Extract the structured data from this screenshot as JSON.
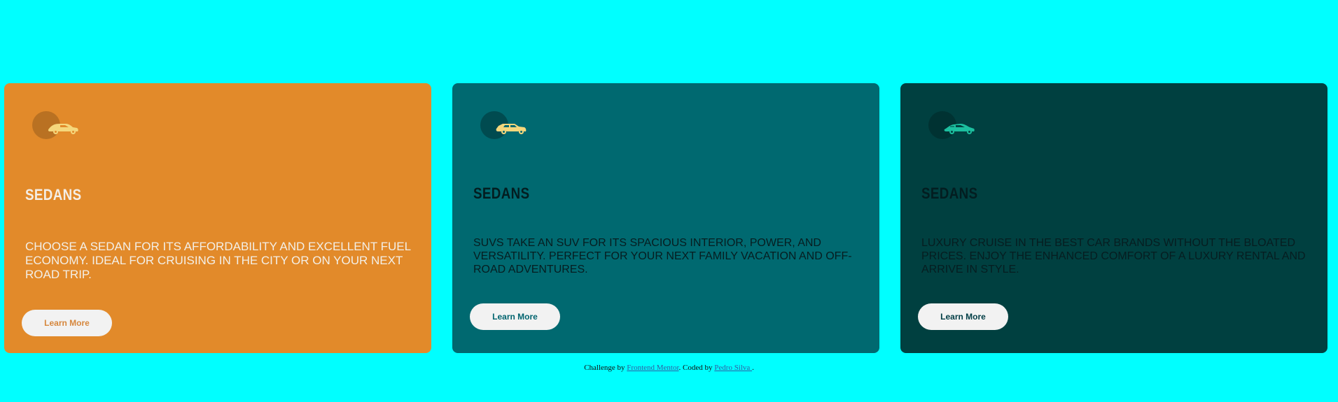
{
  "cards": [
    {
      "title": "SEDANS",
      "description": "CHOOSE A SEDAN FOR ITS AFFORDABILITY AND EXCELLENT FUEL ECONOMY. IDEAL FOR CRUISING IN THE CITY OR ON YOUR NEXT ROAD TRIP.",
      "button_label": "Learn More",
      "background_color": "#e28a2a",
      "icon": "sedan-car-icon"
    },
    {
      "title": "SEDANS",
      "description": "SUVS TAKE AN SUV FOR ITS SPACIOUS INTERIOR, POWER, AND VERSATILITY. PERFECT FOR YOUR NEXT FAMILY VACATION AND OFF-ROAD ADVENTURES.",
      "button_label": "Learn More",
      "background_color": "#006970",
      "icon": "suv-car-icon"
    },
    {
      "title": "SEDANS",
      "description": "LUXURY CRUISE IN THE BEST CAR BRANDS WITHOUT THE BLOATED PRICES. ENJOY THE ENHANCED COMFORT OF A LUXURY RENTAL AND ARRIVE IN STYLE.",
      "button_label": "Learn More",
      "background_color": "#004040",
      "icon": "luxury-car-icon"
    }
  ],
  "footer": {
    "prefix": "Challenge by ",
    "link1": "Frontend Mentor",
    "middle": ". Coded by ",
    "link2": "Pedro Silva ",
    "suffix": "."
  },
  "colors": {
    "page_background": "#00ffff",
    "button_background": "#f2f2f2",
    "icon_yellow": "#f5d77c",
    "icon_green": "#1cbf9f"
  }
}
